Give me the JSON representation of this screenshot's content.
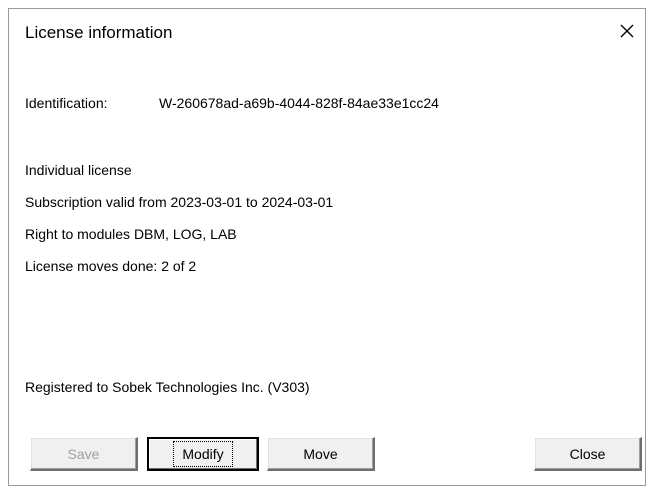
{
  "window": {
    "title": "License information",
    "close_glyph": "✕"
  },
  "info": {
    "identification_label": "Identification:",
    "identification_value": "W-260678ad-a69b-4044-828f-84ae33e1cc24",
    "license_type": "Individual license",
    "subscription": "Subscription valid from 2023-03-01 to 2024-03-01",
    "modules": "Right to modules DBM, LOG, LAB",
    "moves": "License moves done: 2 of 2",
    "registered": "Registered to Sobek Technologies Inc. (V303)"
  },
  "buttons": {
    "save": "Save",
    "modify": "Modify",
    "move": "Move",
    "close": "Close"
  },
  "icons": {
    "close": "close-icon"
  }
}
